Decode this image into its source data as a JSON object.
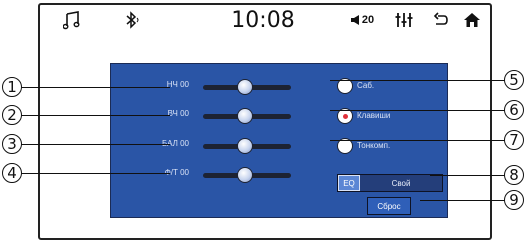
{
  "statusbar": {
    "clock": "10:08",
    "volume": "20",
    "icons": [
      "music-note-icon",
      "bluetooth-icon",
      "volume-icon",
      "equalizer-icon",
      "back-icon",
      "home-icon"
    ]
  },
  "sliders": [
    {
      "label": "НЧ  00",
      "value": "00"
    },
    {
      "label": "ВЧ  00",
      "value": "00"
    },
    {
      "label": "БАЛ  00",
      "value": "00"
    },
    {
      "label": "Ф/Т  00",
      "value": "00"
    }
  ],
  "options": [
    {
      "label": "Саб.",
      "selected": false
    },
    {
      "label": "Клавиши",
      "selected": true
    },
    {
      "label": "Тонкомп.",
      "selected": false
    }
  ],
  "eq": {
    "tab_a": "EQ",
    "tab_b": "Свой"
  },
  "reset": "Сброс",
  "callouts": [
    "1",
    "2",
    "3",
    "4",
    "5",
    "6",
    "7",
    "8",
    "9"
  ],
  "colors": {
    "panel": "#2a55a6",
    "accent_selected": "#e0303a"
  }
}
